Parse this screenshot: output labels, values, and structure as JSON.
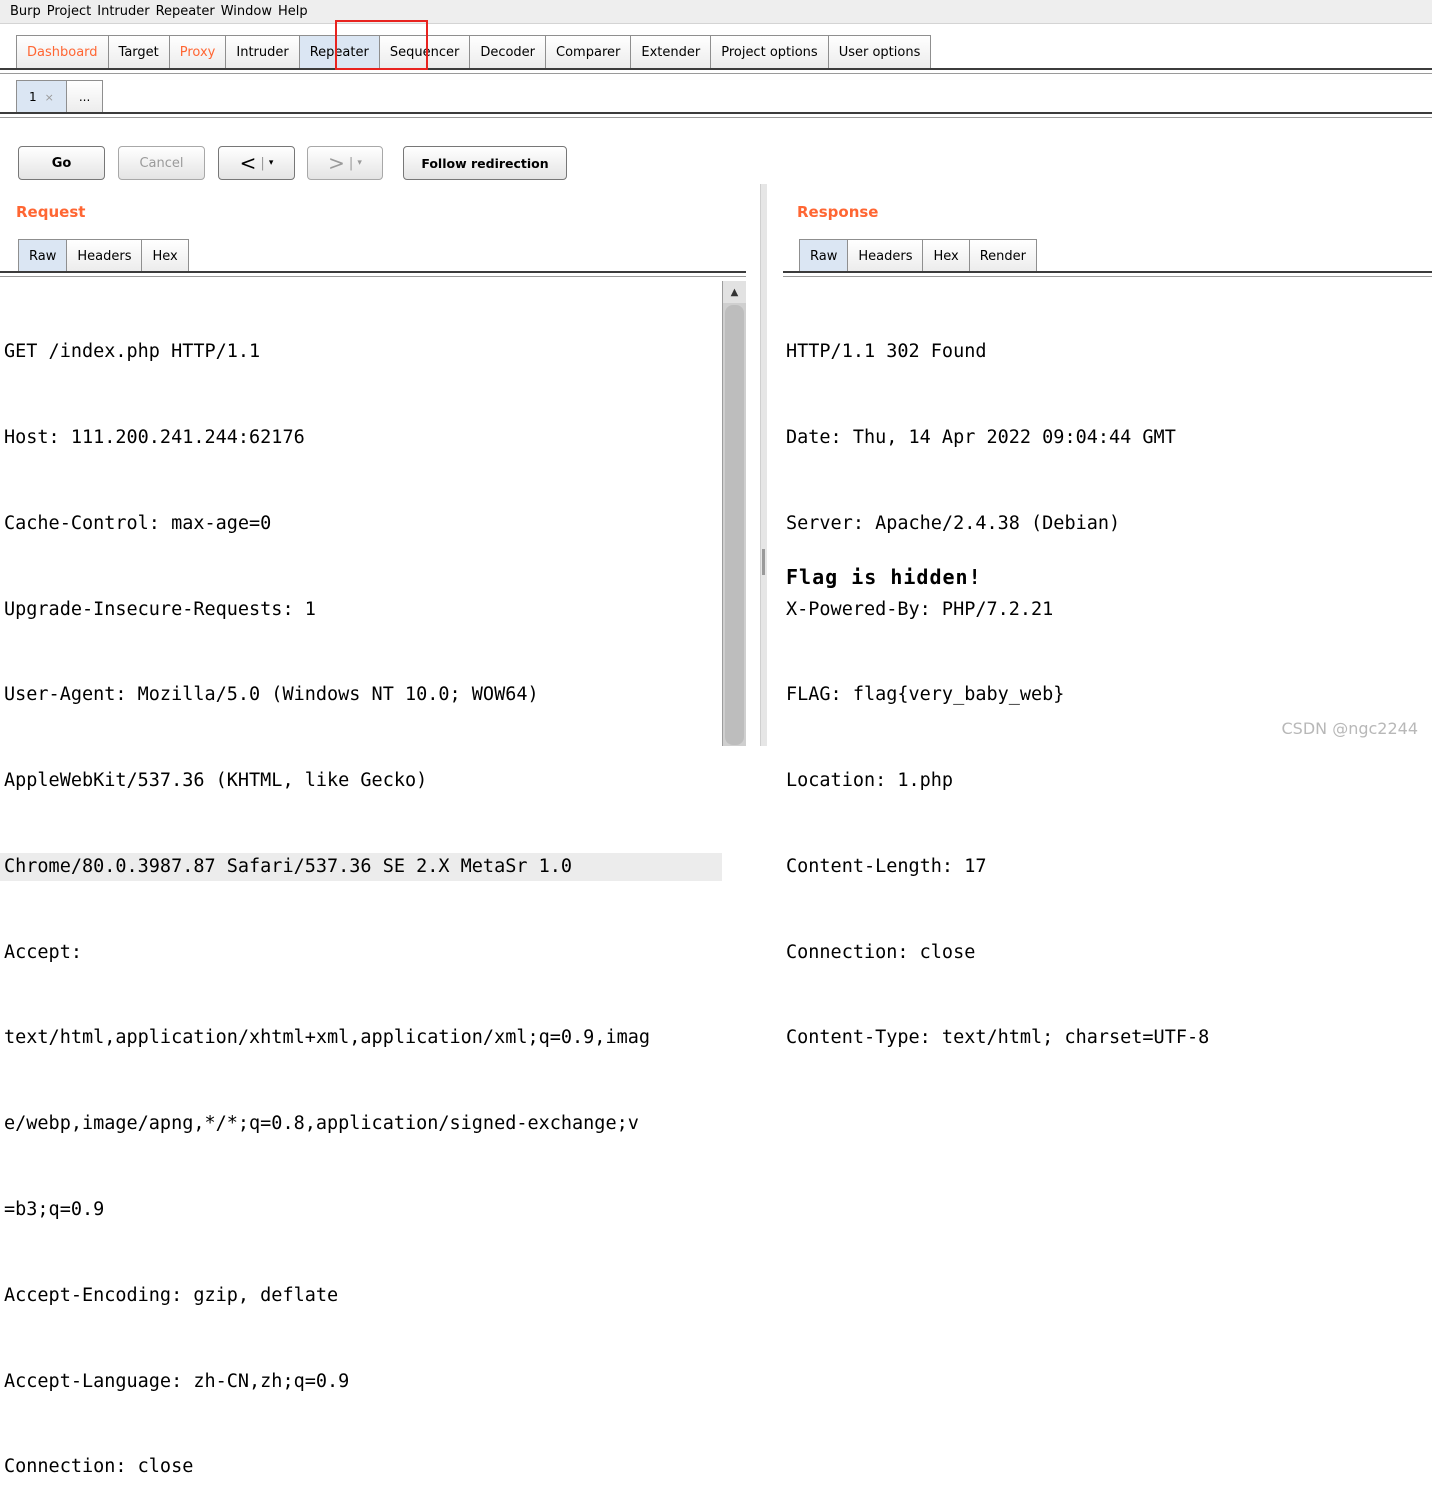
{
  "menu": [
    "Burp",
    "Project",
    "Intruder",
    "Repeater",
    "Window",
    "Help"
  ],
  "main_tabs": [
    {
      "label": "Dashboard",
      "color": "#ff6633"
    },
    {
      "label": "Target"
    },
    {
      "label": "Proxy",
      "color": "#ff6633"
    },
    {
      "label": "Intruder"
    },
    {
      "label": "Repeater",
      "active": true
    },
    {
      "label": "Sequencer"
    },
    {
      "label": "Decoder"
    },
    {
      "label": "Comparer"
    },
    {
      "label": "Extender"
    },
    {
      "label": "Project options"
    },
    {
      "label": "User options"
    }
  ],
  "repeater_tabs": {
    "tab1": "1",
    "close": "×",
    "more": "..."
  },
  "toolbar": {
    "go": "Go",
    "cancel": "Cancel",
    "back": "<",
    "forward": ">",
    "dropdown": "▾",
    "follow": "Follow redirection"
  },
  "request": {
    "title": "Request",
    "tabs": [
      "Raw",
      "Headers",
      "Hex"
    ],
    "lines": [
      "GET /index.php HTTP/1.1",
      "Host: 111.200.241.244:62176",
      "Cache-Control: max-age=0",
      "Upgrade-Insecure-Requests: 1",
      "User-Agent: Mozilla/5.0 (Windows NT 10.0; WOW64)",
      "AppleWebKit/537.36 (KHTML, like Gecko)",
      "Chrome/80.0.3987.87 Safari/537.36 SE 2.X MetaSr 1.0",
      "Accept:",
      "text/html,application/xhtml+xml,application/xml;q=0.9,imag",
      "e/webp,image/apng,*/*;q=0.8,application/signed-exchange;v",
      "=b3;q=0.9",
      "Accept-Encoding: gzip, deflate",
      "Accept-Language: zh-CN,zh;q=0.9",
      "Connection: close"
    ]
  },
  "response": {
    "title": "Response",
    "tabs": [
      "Raw",
      "Headers",
      "Hex",
      "Render"
    ],
    "lines": [
      "HTTP/1.1 302 Found",
      "Date: Thu, 14 Apr 2022 09:04:44 GMT",
      "Server: Apache/2.4.38 (Debian)",
      "X-Powered-By: PHP/7.2.21",
      "FLAG: flag{very_baby_web}",
      "Location: 1.php",
      "Content-Length: 17",
      "Connection: close",
      "Content-Type: text/html; charset=UTF-8"
    ],
    "body": "Flag is hidden!"
  },
  "watermark": "CSDN @ngc2244"
}
